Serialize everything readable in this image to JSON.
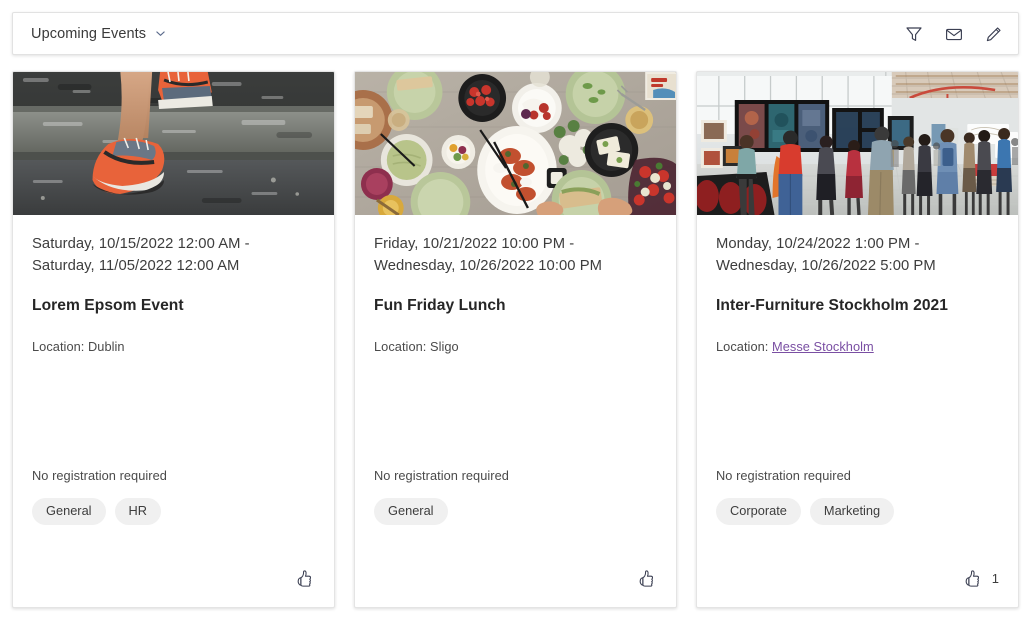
{
  "header": {
    "title": "Upcoming Events",
    "dropdown_icon": "chevron-down-icon",
    "icons": [
      {
        "name": "filter-icon",
        "label": "Filter"
      },
      {
        "name": "mail-icon",
        "label": "Mail"
      },
      {
        "name": "edit-icon",
        "label": "Edit"
      }
    ]
  },
  "colors": {
    "page_background": "#ffffff",
    "card_background": "#ffffff",
    "card_border": "#e4e4e4",
    "text_primary": "#262626",
    "text_secondary": "#4a4a4a",
    "tag_background": "#f0f0f0",
    "link": "#7a4fa3"
  },
  "cards": [
    {
      "image": {
        "name": "running-shoes-on-stairs-photo",
        "alt": "Legs in orange and grey running shoes climbing concrete steps"
      },
      "date": "Saturday, 10/15/2022 12:00 AM - Saturday, 11/05/2022 12:00 AM",
      "title": "Lorem Epsom Event",
      "location_label": "Location:",
      "location_value": "Dublin",
      "location_is_link": false,
      "registration": "No registration required",
      "tags": [
        "General",
        "HR"
      ],
      "like_count": ""
    },
    {
      "image": {
        "name": "food-table-flatlay-photo",
        "alt": "Overhead view of a table spread with green plates, dips, tomatoes and salads"
      },
      "date": "Friday, 10/21/2022 10:00 PM - Wednesday, 10/26/2022 10:00 PM",
      "title": "Fun Friday Lunch",
      "location_label": "Location:",
      "location_value": "Sligo",
      "location_is_link": false,
      "registration": "No registration required",
      "tags": [
        "General"
      ],
      "like_count": ""
    },
    {
      "image": {
        "name": "art-exhibition-hall-photo",
        "alt": "People walking through a bright exhibition hall viewing framed artwork"
      },
      "date": "Monday, 10/24/2022 1:00 PM - Wednesday, 10/26/2022 5:00 PM",
      "title": "Inter-Furniture Stockholm 2021",
      "location_label": "Location:",
      "location_value": "Messe Stockholm",
      "location_is_link": true,
      "registration": "No registration required",
      "tags": [
        "Corporate",
        "Marketing"
      ],
      "like_count": "1"
    }
  ]
}
